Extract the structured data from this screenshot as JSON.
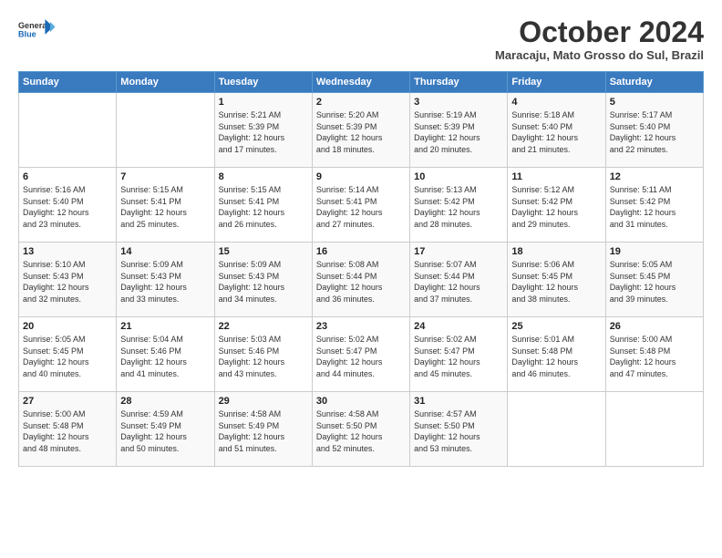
{
  "header": {
    "logo_general": "General",
    "logo_blue": "Blue",
    "month_title": "October 2024",
    "location": "Maracaju, Mato Grosso do Sul, Brazil"
  },
  "weekdays": [
    "Sunday",
    "Monday",
    "Tuesday",
    "Wednesday",
    "Thursday",
    "Friday",
    "Saturday"
  ],
  "weeks": [
    [
      {
        "day": "",
        "detail": ""
      },
      {
        "day": "",
        "detail": ""
      },
      {
        "day": "1",
        "detail": "Sunrise: 5:21 AM\nSunset: 5:39 PM\nDaylight: 12 hours\nand 17 minutes."
      },
      {
        "day": "2",
        "detail": "Sunrise: 5:20 AM\nSunset: 5:39 PM\nDaylight: 12 hours\nand 18 minutes."
      },
      {
        "day": "3",
        "detail": "Sunrise: 5:19 AM\nSunset: 5:39 PM\nDaylight: 12 hours\nand 20 minutes."
      },
      {
        "day": "4",
        "detail": "Sunrise: 5:18 AM\nSunset: 5:40 PM\nDaylight: 12 hours\nand 21 minutes."
      },
      {
        "day": "5",
        "detail": "Sunrise: 5:17 AM\nSunset: 5:40 PM\nDaylight: 12 hours\nand 22 minutes."
      }
    ],
    [
      {
        "day": "6",
        "detail": "Sunrise: 5:16 AM\nSunset: 5:40 PM\nDaylight: 12 hours\nand 23 minutes."
      },
      {
        "day": "7",
        "detail": "Sunrise: 5:15 AM\nSunset: 5:41 PM\nDaylight: 12 hours\nand 25 minutes."
      },
      {
        "day": "8",
        "detail": "Sunrise: 5:15 AM\nSunset: 5:41 PM\nDaylight: 12 hours\nand 26 minutes."
      },
      {
        "day": "9",
        "detail": "Sunrise: 5:14 AM\nSunset: 5:41 PM\nDaylight: 12 hours\nand 27 minutes."
      },
      {
        "day": "10",
        "detail": "Sunrise: 5:13 AM\nSunset: 5:42 PM\nDaylight: 12 hours\nand 28 minutes."
      },
      {
        "day": "11",
        "detail": "Sunrise: 5:12 AM\nSunset: 5:42 PM\nDaylight: 12 hours\nand 29 minutes."
      },
      {
        "day": "12",
        "detail": "Sunrise: 5:11 AM\nSunset: 5:42 PM\nDaylight: 12 hours\nand 31 minutes."
      }
    ],
    [
      {
        "day": "13",
        "detail": "Sunrise: 5:10 AM\nSunset: 5:43 PM\nDaylight: 12 hours\nand 32 minutes."
      },
      {
        "day": "14",
        "detail": "Sunrise: 5:09 AM\nSunset: 5:43 PM\nDaylight: 12 hours\nand 33 minutes."
      },
      {
        "day": "15",
        "detail": "Sunrise: 5:09 AM\nSunset: 5:43 PM\nDaylight: 12 hours\nand 34 minutes."
      },
      {
        "day": "16",
        "detail": "Sunrise: 5:08 AM\nSunset: 5:44 PM\nDaylight: 12 hours\nand 36 minutes."
      },
      {
        "day": "17",
        "detail": "Sunrise: 5:07 AM\nSunset: 5:44 PM\nDaylight: 12 hours\nand 37 minutes."
      },
      {
        "day": "18",
        "detail": "Sunrise: 5:06 AM\nSunset: 5:45 PM\nDaylight: 12 hours\nand 38 minutes."
      },
      {
        "day": "19",
        "detail": "Sunrise: 5:05 AM\nSunset: 5:45 PM\nDaylight: 12 hours\nand 39 minutes."
      }
    ],
    [
      {
        "day": "20",
        "detail": "Sunrise: 5:05 AM\nSunset: 5:45 PM\nDaylight: 12 hours\nand 40 minutes."
      },
      {
        "day": "21",
        "detail": "Sunrise: 5:04 AM\nSunset: 5:46 PM\nDaylight: 12 hours\nand 41 minutes."
      },
      {
        "day": "22",
        "detail": "Sunrise: 5:03 AM\nSunset: 5:46 PM\nDaylight: 12 hours\nand 43 minutes."
      },
      {
        "day": "23",
        "detail": "Sunrise: 5:02 AM\nSunset: 5:47 PM\nDaylight: 12 hours\nand 44 minutes."
      },
      {
        "day": "24",
        "detail": "Sunrise: 5:02 AM\nSunset: 5:47 PM\nDaylight: 12 hours\nand 45 minutes."
      },
      {
        "day": "25",
        "detail": "Sunrise: 5:01 AM\nSunset: 5:48 PM\nDaylight: 12 hours\nand 46 minutes."
      },
      {
        "day": "26",
        "detail": "Sunrise: 5:00 AM\nSunset: 5:48 PM\nDaylight: 12 hours\nand 47 minutes."
      }
    ],
    [
      {
        "day": "27",
        "detail": "Sunrise: 5:00 AM\nSunset: 5:48 PM\nDaylight: 12 hours\nand 48 minutes."
      },
      {
        "day": "28",
        "detail": "Sunrise: 4:59 AM\nSunset: 5:49 PM\nDaylight: 12 hours\nand 50 minutes."
      },
      {
        "day": "29",
        "detail": "Sunrise: 4:58 AM\nSunset: 5:49 PM\nDaylight: 12 hours\nand 51 minutes."
      },
      {
        "day": "30",
        "detail": "Sunrise: 4:58 AM\nSunset: 5:50 PM\nDaylight: 12 hours\nand 52 minutes."
      },
      {
        "day": "31",
        "detail": "Sunrise: 4:57 AM\nSunset: 5:50 PM\nDaylight: 12 hours\nand 53 minutes."
      },
      {
        "day": "",
        "detail": ""
      },
      {
        "day": "",
        "detail": ""
      }
    ]
  ]
}
